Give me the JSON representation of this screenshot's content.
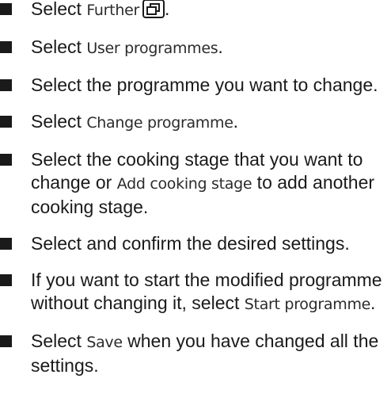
{
  "steps": [
    {
      "pre": "Select ",
      "kw": "Further",
      "post": "."
    },
    {
      "pre": "Select ",
      "kw": "User programmes",
      "post": "."
    },
    {
      "text": "Select the programme you want to change."
    },
    {
      "pre": "Select ",
      "kw": "Change programme",
      "post": "."
    },
    {
      "pre": "Select the cooking stage that you want to change or ",
      "kw": "Add cooking stage",
      "post": " to add another cooking stage."
    },
    {
      "text": "Select and confirm the desired settings."
    },
    {
      "pre": "If you want to start the modified programme without changing it, select ",
      "kw": "Start programme",
      "post": "."
    },
    {
      "pre": "Select ",
      "kw": "Save",
      "post": " when you have changed all the settings."
    }
  ],
  "icons": {
    "bullet": "square-bullet-icon",
    "further": "further-windows-icon"
  },
  "colors": {
    "text": "#1a1a1a",
    "background": "#ffffff"
  }
}
